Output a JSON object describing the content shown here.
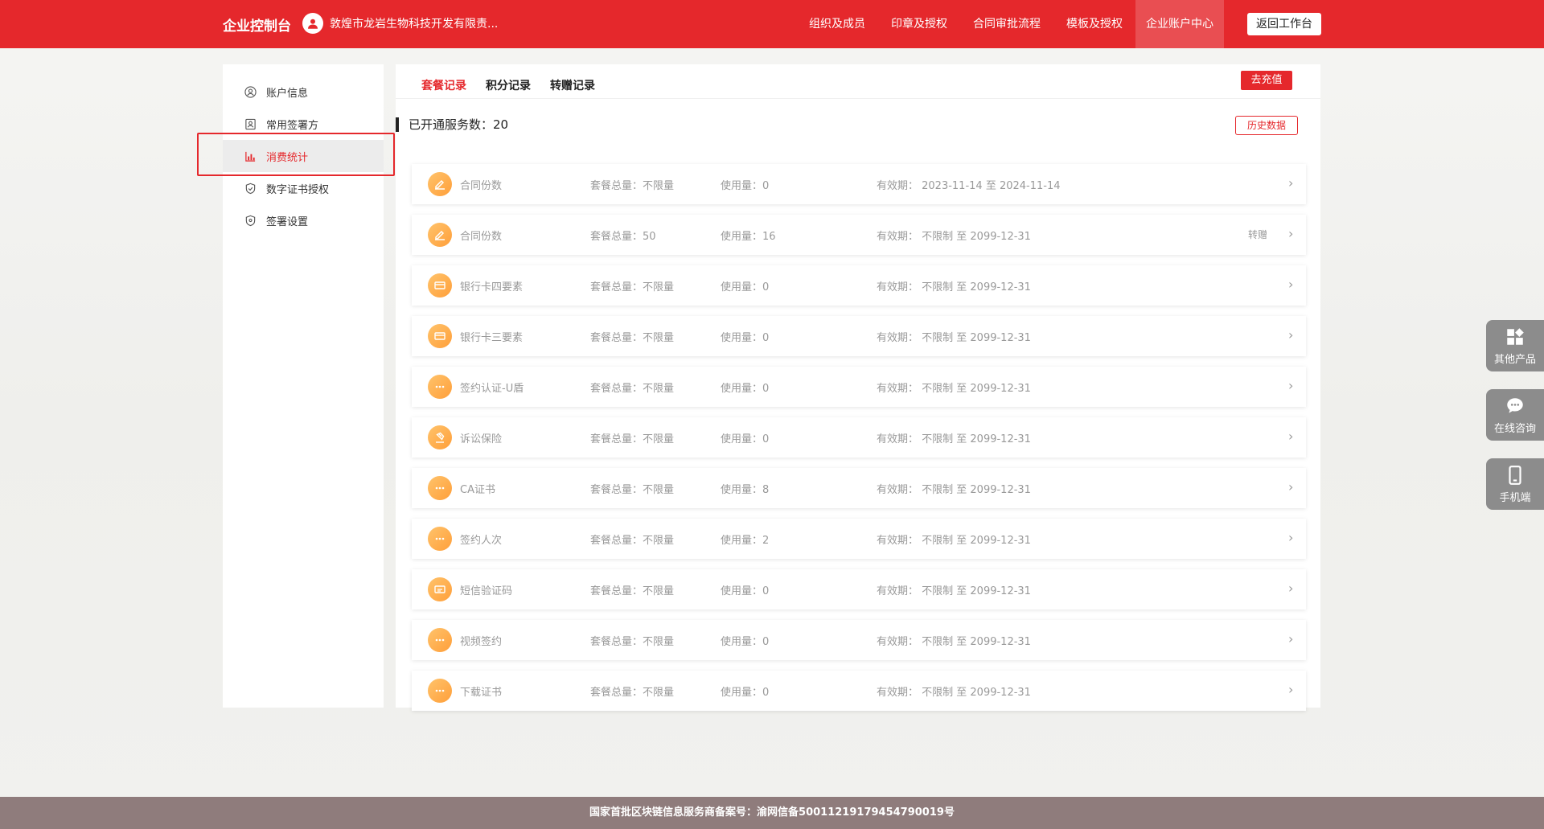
{
  "header": {
    "brand": "企业控制台",
    "company": "敦煌市龙岩生物科技开发有限责...",
    "nav": [
      "组织及成员",
      "印章及授权",
      "合同审批流程",
      "模板及授权",
      "企业账户中心"
    ],
    "active_nav": "企业账户中心",
    "return_label": "返回工作台"
  },
  "sidebar": {
    "items": [
      {
        "label": "账户信息",
        "icon": "user-circle-icon"
      },
      {
        "label": "常用签署方",
        "icon": "contact-card-icon"
      },
      {
        "label": "消费统计",
        "icon": "chart-icon"
      },
      {
        "label": "数字证书授权",
        "icon": "certificate-icon"
      },
      {
        "label": "签署设置",
        "icon": "shield-icon"
      }
    ],
    "active": "消费统计"
  },
  "main": {
    "tabs": [
      "套餐记录",
      "积分记录",
      "转赠记录"
    ],
    "active_tab": "套餐记录",
    "recharge_label": "去充值",
    "service_count_text": "已开通服务数：20",
    "history_label": "历史数据",
    "rows": [
      {
        "icon": "contract-icon",
        "name": "合同份数",
        "total": "套餐总量：不限量",
        "used": "使用量：0",
        "valid": "有效期：  2023-11-14 至 2024-11-14",
        "transfer": ""
      },
      {
        "icon": "contract-icon",
        "name": "合同份数",
        "total": "套餐总量：50",
        "used": "使用量：16",
        "valid": "有效期：  不限制 至 2099-12-31",
        "transfer": "转赠"
      },
      {
        "icon": "card-icon",
        "name": "银行卡四要素",
        "total": "套餐总量：不限量",
        "used": "使用量：0",
        "valid": "有效期：  不限制 至 2099-12-31",
        "transfer": ""
      },
      {
        "icon": "card-icon",
        "name": "银行卡三要素",
        "total": "套餐总量：不限量",
        "used": "使用量：0",
        "valid": "有效期：  不限制 至 2099-12-31",
        "transfer": ""
      },
      {
        "icon": "more-icon",
        "name": "签约认证-U盾",
        "total": "套餐总量：不限量",
        "used": "使用量：0",
        "valid": "有效期：  不限制 至 2099-12-31",
        "transfer": ""
      },
      {
        "icon": "gavel-icon",
        "name": "诉讼保险",
        "total": "套餐总量：不限量",
        "used": "使用量：0",
        "valid": "有效期：  不限制 至 2099-12-31",
        "transfer": ""
      },
      {
        "icon": "more-icon",
        "name": "CA证书",
        "total": "套餐总量：不限量",
        "used": "使用量：8",
        "valid": "有效期：  不限制 至 2099-12-31",
        "transfer": ""
      },
      {
        "icon": "more-icon",
        "name": "签约人次",
        "total": "套餐总量：不限量",
        "used": "使用量：2",
        "valid": "有效期：  不限制 至 2099-12-31",
        "transfer": ""
      },
      {
        "icon": "sms-icon",
        "name": "短信验证码",
        "total": "套餐总量：不限量",
        "used": "使用量：0",
        "valid": "有效期：  不限制 至 2099-12-31",
        "transfer": ""
      },
      {
        "icon": "more-icon",
        "name": "视频签约",
        "total": "套餐总量：不限量",
        "used": "使用量：0",
        "valid": "有效期：  不限制 至 2099-12-31",
        "transfer": ""
      },
      {
        "icon": "more-icon",
        "name": "下载证书",
        "total": "套餐总量：不限量",
        "used": "使用量：0",
        "valid": "有效期：  不限制 至 2099-12-31",
        "transfer": ""
      }
    ]
  },
  "float_tools": [
    {
      "label": "其他产品",
      "icon": "apps-icon"
    },
    {
      "label": "在线咨询",
      "icon": "chat-icon"
    },
    {
      "label": "手机端",
      "icon": "mobile-icon"
    }
  ],
  "footer": {
    "text": "国家首批区块链信息服务商备案号：渝网信备50011219179454790019号"
  },
  "colors": {
    "brand_red": "#e5282c",
    "icon_orange": "#ffa94a",
    "footer_bg": "#8f7c7c"
  }
}
